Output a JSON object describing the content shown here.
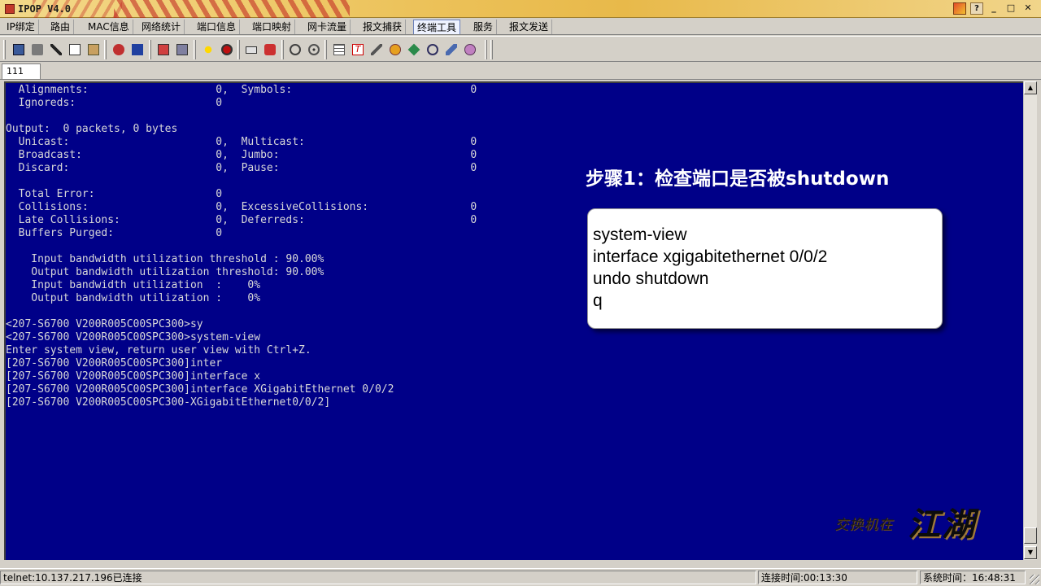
{
  "window": {
    "title": "IPOP V4.0",
    "help_label": "?",
    "minimize_label": "_",
    "restore_label": "□",
    "close_label": "✕"
  },
  "menu": {
    "items": [
      {
        "label": "IP绑定"
      },
      {
        "label": "路由"
      },
      {
        "label": "MAC信息"
      },
      {
        "label": "网络统计"
      },
      {
        "label": "端口信息"
      },
      {
        "label": "端口映射"
      },
      {
        "label": "网卡流量"
      },
      {
        "label": "报文捕获"
      },
      {
        "label": "终端工具",
        "active": true
      },
      {
        "label": "服务"
      },
      {
        "label": "报文发送"
      }
    ]
  },
  "toolbar": {
    "icons": [
      "connect-icon",
      "delete-icon",
      "cut-icon",
      "copy-icon",
      "paste-icon",
      "key-icon",
      "edit-icon",
      "import-icon",
      "export-icon",
      "sun-icon",
      "record-icon",
      "keyboard-icon",
      "script-icon",
      "find-icon",
      "target-icon",
      "table-icon",
      "font-icon",
      "tools-icon",
      "globe-icon",
      "arrow-icon",
      "zoom-icon",
      "link-icon",
      "disconnect-icon"
    ]
  },
  "session": {
    "tab_label": "111"
  },
  "terminal": {
    "lines": [
      "  Alignments:                    0,  Symbols:                            0",
      "  Ignoreds:                      0",
      "",
      "Output:  0 packets, 0 bytes",
      "  Unicast:                       0,  Multicast:                          0",
      "  Broadcast:                     0,  Jumbo:                              0",
      "  Discard:                       0,  Pause:                              0",
      "",
      "  Total Error:                   0",
      "  Collisions:                    0,  ExcessiveCollisions:                0",
      "  Late Collisions:               0,  Deferreds:                          0",
      "  Buffers Purged:                0",
      "",
      "    Input bandwidth utilization threshold : 90.00%",
      "    Output bandwidth utilization threshold: 90.00%",
      "    Input bandwidth utilization  :    0%",
      "    Output bandwidth utilization :    0%",
      "",
      "<207-S6700 V200R005C00SPC300>sy",
      "<207-S6700 V200R005C00SPC300>system-view",
      "Enter system view, return user view with Ctrl+Z.",
      "[207-S6700 V200R005C00SPC300]inter",
      "[207-S6700 V200R005C00SPC300]interface x",
      "[207-S6700 V200R005C00SPC300]interface XGigabitEthernet 0/0/2",
      "[207-S6700 V200R005C00SPC300-XGigabitEthernet0/0/2]"
    ]
  },
  "annotation": {
    "heading": "步骤1：检查端口是否被shutdown",
    "commands": [
      "system-view",
      "interface xgigabitethernet 0/0/2",
      "undo shutdown",
      "q"
    ]
  },
  "watermark": {
    "small": "交换机在",
    "big": "江湖"
  },
  "status": {
    "connection": "telnet:10.137.217.196已连接",
    "connect_time": "连接时间:00:13:30",
    "system_time": "系统时间：16:48:31"
  },
  "colors": {
    "terminal_bg": "#000088",
    "terminal_fg": "#d8d8d8",
    "active_tab": "#eef2ff"
  }
}
